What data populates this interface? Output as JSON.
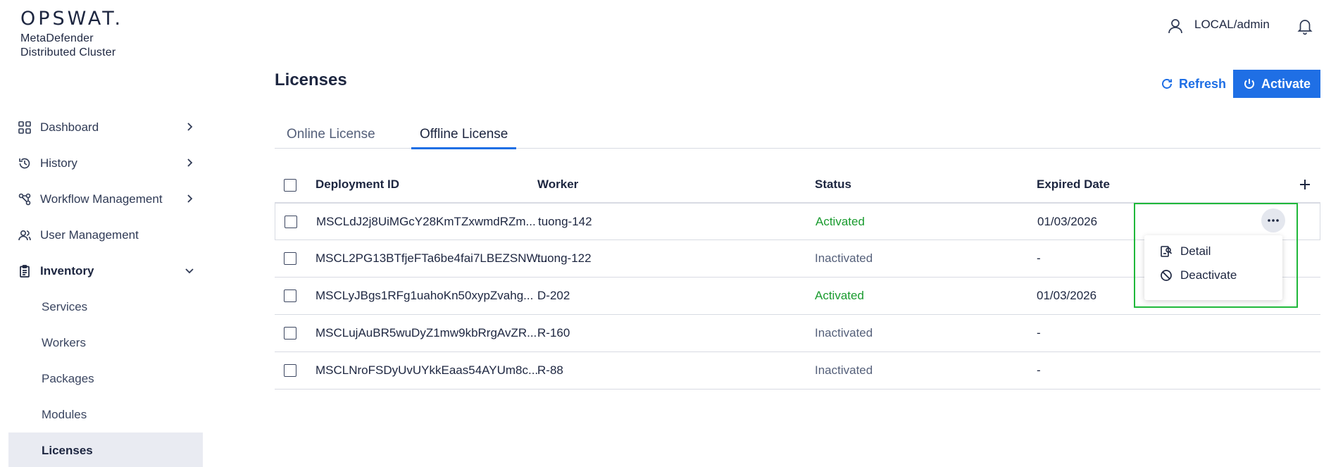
{
  "brand": {
    "logo_text": "OPSWAT.",
    "product_line1": "MetaDefender",
    "product_line2": "Distributed Cluster"
  },
  "header": {
    "user": "LOCAL/admin"
  },
  "sidebar": {
    "items": [
      {
        "label": "Dashboard"
      },
      {
        "label": "History"
      },
      {
        "label": "Workflow Management"
      },
      {
        "label": "User Management"
      },
      {
        "label": "Inventory"
      }
    ],
    "inventory_sub": [
      {
        "label": "Services"
      },
      {
        "label": "Workers"
      },
      {
        "label": "Packages"
      },
      {
        "label": "Modules"
      },
      {
        "label": "Licenses"
      }
    ]
  },
  "page": {
    "title": "Licenses",
    "refresh_label": "Refresh",
    "activate_label": "Activate",
    "tabs": [
      {
        "label": "Online License"
      },
      {
        "label": "Offline License"
      }
    ],
    "active_tab": "Offline License"
  },
  "table": {
    "columns": [
      "Deployment ID",
      "Worker",
      "Status",
      "Expired Date"
    ],
    "rows": [
      {
        "id": "MSCLdJ2j8UiMGcY28KmTZxwmdRZm...",
        "worker": "tuong-142",
        "status": "Activated",
        "date": "01/03/2026"
      },
      {
        "id": "MSCL2PG13BTfjeFTa6be4fai7LBEZSNW...",
        "worker": "tuong-122",
        "status": "Inactivated",
        "date": "-"
      },
      {
        "id": "MSCLyJBgs1RFg1uahoKn50xypZvahg...",
        "worker": "D-202",
        "status": "Activated",
        "date": "01/03/2026"
      },
      {
        "id": "MSCLujAuBR5wuDyZ1mw9kbRrgAvZR...",
        "worker": "R-160",
        "status": "Inactivated",
        "date": "-"
      },
      {
        "id": "MSCLNroFSDyUvUYkkEaas54AYUm8c...",
        "worker": "R-88",
        "status": "Inactivated",
        "date": "-"
      }
    ]
  },
  "context_menu": {
    "items": [
      {
        "label": "Detail"
      },
      {
        "label": "Deactivate"
      }
    ]
  },
  "colors": {
    "accent": "#1f6fe5",
    "status_active": "#1a9b2f",
    "highlight": "#1fb83a",
    "sidebar_active_bg": "#e9ebf2"
  }
}
